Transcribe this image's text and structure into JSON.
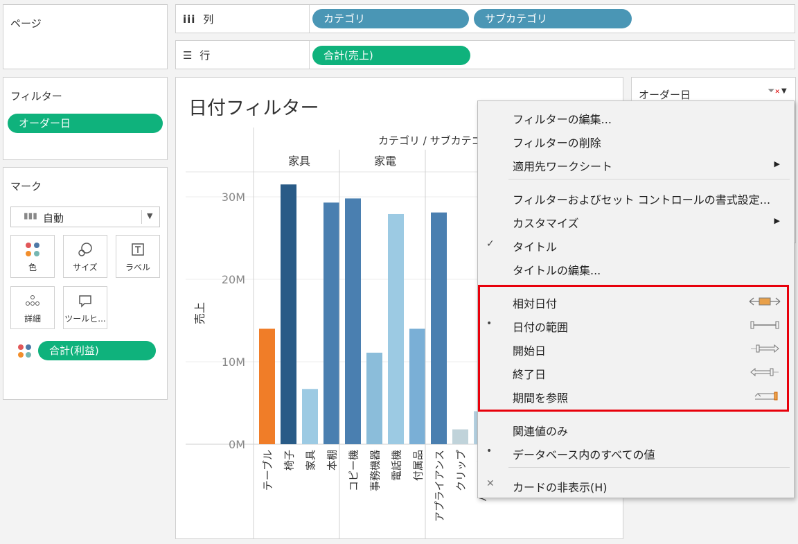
{
  "pages": {
    "title": "ページ"
  },
  "columns": {
    "label": "列",
    "pills": [
      "カテゴリ",
      "サブカテゴリ"
    ]
  },
  "rows": {
    "label": "行",
    "pills": [
      "合計(売上)"
    ]
  },
  "filters": {
    "title": "フィルター",
    "pill": "オーダー日"
  },
  "marks": {
    "title": "マーク",
    "type_label": "自動",
    "buttons": [
      "色",
      "サイズ",
      "ラベル",
      "詳細",
      "ツールヒ..."
    ],
    "field_pill": "合計(利益)"
  },
  "sheet": {
    "title": "日付フィルター"
  },
  "filter_card": {
    "title": "オーダー日"
  },
  "chart_data": {
    "type": "bar",
    "header": "カテゴリ / サブカテゴリ",
    "ylabel": "売上",
    "ylim": [
      0,
      33000000
    ],
    "yticks": [
      "0M",
      "10M",
      "20M",
      "30M"
    ],
    "groups": [
      {
        "name": "家具",
        "categories": [
          "テーブル",
          "椅子",
          "家具",
          "本棚"
        ]
      },
      {
        "name": "家電",
        "categories": [
          "コピー機",
          "事務機器",
          "電話機",
          "付属品"
        ]
      },
      {
        "name": "",
        "categories": [
          "アプライアンス",
          "クリップ",
          "バインダー"
        ]
      }
    ],
    "values": [
      14000000,
      31500000,
      6700000,
      29300000,
      29800000,
      11100000,
      27900000,
      14000000,
      28100000,
      1800000,
      4000000
    ],
    "colors": [
      "#f07d28",
      "#295b87",
      "#9ccae3",
      "#4a7fb0",
      "#4a7fb0",
      "#8bbdda",
      "#9ccae3",
      "#7aafd6",
      "#4a7fb0",
      "#c0d3da",
      "#b4d0e0"
    ]
  },
  "menu": {
    "items": [
      {
        "label": "フィルターの編集..."
      },
      {
        "label": "フィルターの削除"
      },
      {
        "label": "適用先ワークシート",
        "submenu": true
      },
      {
        "label": "フィルターおよびセット コントロールの書式設定..."
      },
      {
        "label": "カスタマイズ",
        "submenu": true
      },
      {
        "label": "タイトル",
        "checked": true
      },
      {
        "label": "タイトルの編集..."
      },
      {
        "label": "相対日付"
      },
      {
        "label": "日付の範囲",
        "selected": true
      },
      {
        "label": "開始日"
      },
      {
        "label": "終了日"
      },
      {
        "label": "期間を参照"
      },
      {
        "label": "関連値のみ"
      },
      {
        "label": "データベース内のすべての値",
        "selected": true
      },
      {
        "label": "カードの非表示(H)"
      }
    ],
    "check_mark": "✓",
    "bullet_mark": "•",
    "close_mark": "✕",
    "submenu_arrow": "▶",
    "highlight_color": "#e8000b"
  }
}
